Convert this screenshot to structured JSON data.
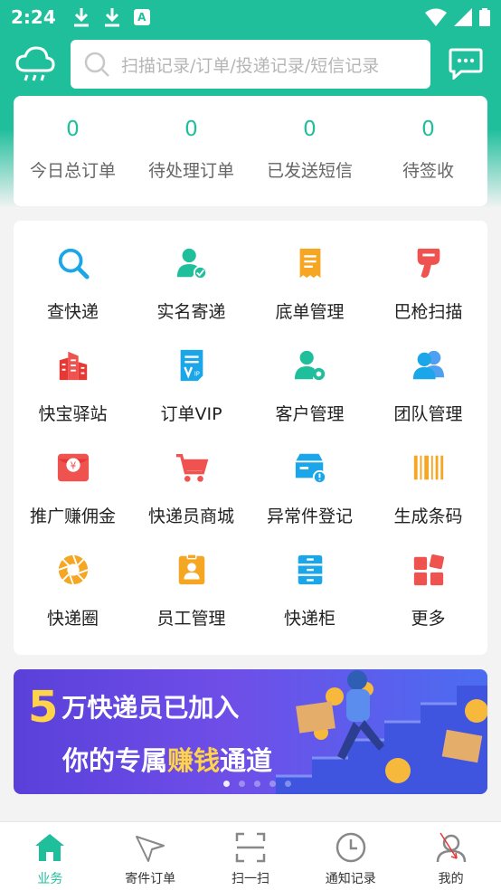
{
  "status_bar": {
    "time": "2:24",
    "badge": "A"
  },
  "search": {
    "placeholder": "扫描记录/订单/投递记录/短信记录"
  },
  "stats": [
    {
      "value": "0",
      "label": "今日总订单"
    },
    {
      "value": "0",
      "label": "待处理订单"
    },
    {
      "value": "0",
      "label": "已发送短信"
    },
    {
      "value": "0",
      "label": "待签收"
    }
  ],
  "grid": [
    {
      "label": "查快递",
      "icon": "search-icon",
      "color": "#1aa6e8"
    },
    {
      "label": "实名寄递",
      "icon": "verified-user-icon",
      "color": "#1fbf9c"
    },
    {
      "label": "底单管理",
      "icon": "receipt-icon",
      "color": "#f5a623"
    },
    {
      "label": "巴枪扫描",
      "icon": "scanner-gun-icon",
      "color": "#ef5350"
    },
    {
      "label": "快宝驿站",
      "icon": "building-icon",
      "color": "#ef5350"
    },
    {
      "label": "订单VIP",
      "icon": "vip-document-icon",
      "color": "#1aa6e8"
    },
    {
      "label": "客户管理",
      "icon": "user-settings-icon",
      "color": "#1fbf9c"
    },
    {
      "label": "团队管理",
      "icon": "team-icon",
      "color": "#1aa6e8"
    },
    {
      "label": "推广赚佣金",
      "icon": "red-envelope-icon",
      "color": "#ef5350"
    },
    {
      "label": "快递员商城",
      "icon": "shopping-cart-icon",
      "color": "#ef5350"
    },
    {
      "label": "异常件登记",
      "icon": "package-alert-icon",
      "color": "#1aa6e8"
    },
    {
      "label": "生成条码",
      "icon": "barcode-icon",
      "color": "#f5a623"
    },
    {
      "label": "快递圈",
      "icon": "aperture-icon",
      "color": "#f5a623"
    },
    {
      "label": "员工管理",
      "icon": "employee-badge-icon",
      "color": "#f5a623"
    },
    {
      "label": "快递柜",
      "icon": "locker-icon",
      "color": "#1aa6e8"
    },
    {
      "label": "更多",
      "icon": "more-grid-icon",
      "color": "#ef5350"
    }
  ],
  "banner": {
    "line1_num": "5",
    "line1_text": "万快递员已加入",
    "line2_a": "你的专属",
    "line2_highlight": "赚钱",
    "line2_b": "通道"
  },
  "tabs": [
    {
      "label": "业务",
      "icon": "home-icon"
    },
    {
      "label": "寄件订单",
      "icon": "send-icon"
    },
    {
      "label": "扫一扫",
      "icon": "scan-icon"
    },
    {
      "label": "通知记录",
      "icon": "clock-icon"
    },
    {
      "label": "我的",
      "icon": "profile-icon"
    }
  ],
  "colors": {
    "brand": "#1fbf9c"
  }
}
